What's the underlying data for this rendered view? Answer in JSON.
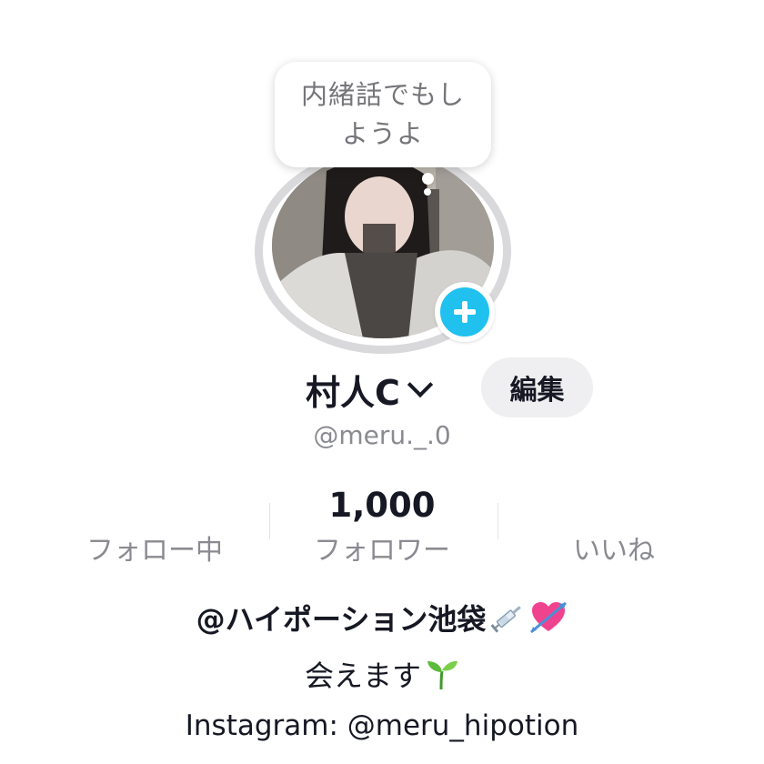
{
  "note": {
    "text": "内緒話でもしようよ"
  },
  "profile": {
    "display_name": "村人C",
    "edit_label": "編集",
    "username": "@meru._.0"
  },
  "stats": [
    {
      "value": "",
      "label": "フォロー中"
    },
    {
      "value": "1,000",
      "label": "フォロワー"
    },
    {
      "value": "",
      "label": "いいね"
    }
  ],
  "bio": {
    "line1": "@ハイポーション池袋",
    "line1_emojis": [
      "syringe-icon",
      "heart-with-arrow-icon"
    ],
    "line2": "会えます",
    "line2_emoji": "seedling-icon",
    "line3": "Instagram: @meru_hipotion"
  },
  "colors": {
    "add_badge": "#20c1ef",
    "text_primary": "#161823",
    "text_secondary": "#8a8b91",
    "button_bg": "#efeff1",
    "ring": "#d9d9db"
  }
}
